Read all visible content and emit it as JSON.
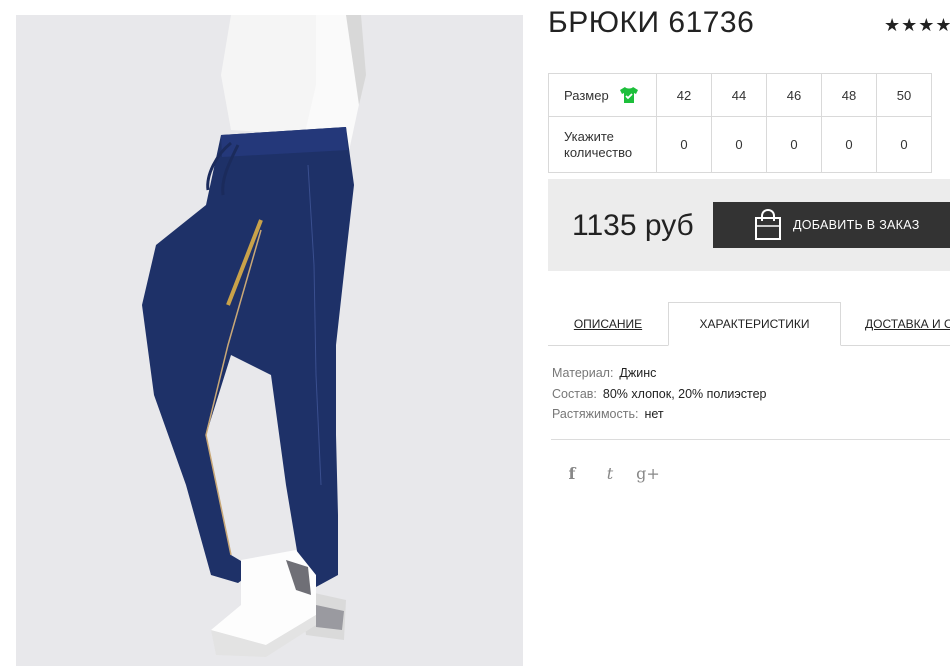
{
  "product": {
    "title": "БРЮКИ 61736",
    "rating_stars": "★★★★",
    "image_alt": "woman wearing dark blue jeans trousers with zipper pocket and white sneakers"
  },
  "sizes": {
    "size_label": "Размер",
    "qty_label": "Укажите количество",
    "values": [
      "42",
      "44",
      "46",
      "48",
      "50"
    ],
    "quantities": [
      "0",
      "0",
      "0",
      "0",
      "0"
    ]
  },
  "purchase": {
    "price": "1135 руб",
    "button_label": "ДОБАВИТЬ В ЗАКАЗ"
  },
  "tabs": {
    "description": "ОПИСАНИЕ",
    "characteristics": "ХАРАКТЕРИСТИКИ",
    "delivery": "ДОСТАВКА И О"
  },
  "properties": [
    {
      "key": "Материал:",
      "value": "Джинс"
    },
    {
      "key": "Состав:",
      "value": "80% хлопок, 20% полиэстер"
    },
    {
      "key": "Растяжимость:",
      "value": "нет"
    }
  ],
  "social": {
    "facebook": "f",
    "twitter": "t",
    "google": "g+"
  },
  "colors": {
    "button_bg": "#333333",
    "shirt_icon": "#1dbf3b",
    "buybox_bg": "#ececec",
    "denim": "#1e3168"
  }
}
